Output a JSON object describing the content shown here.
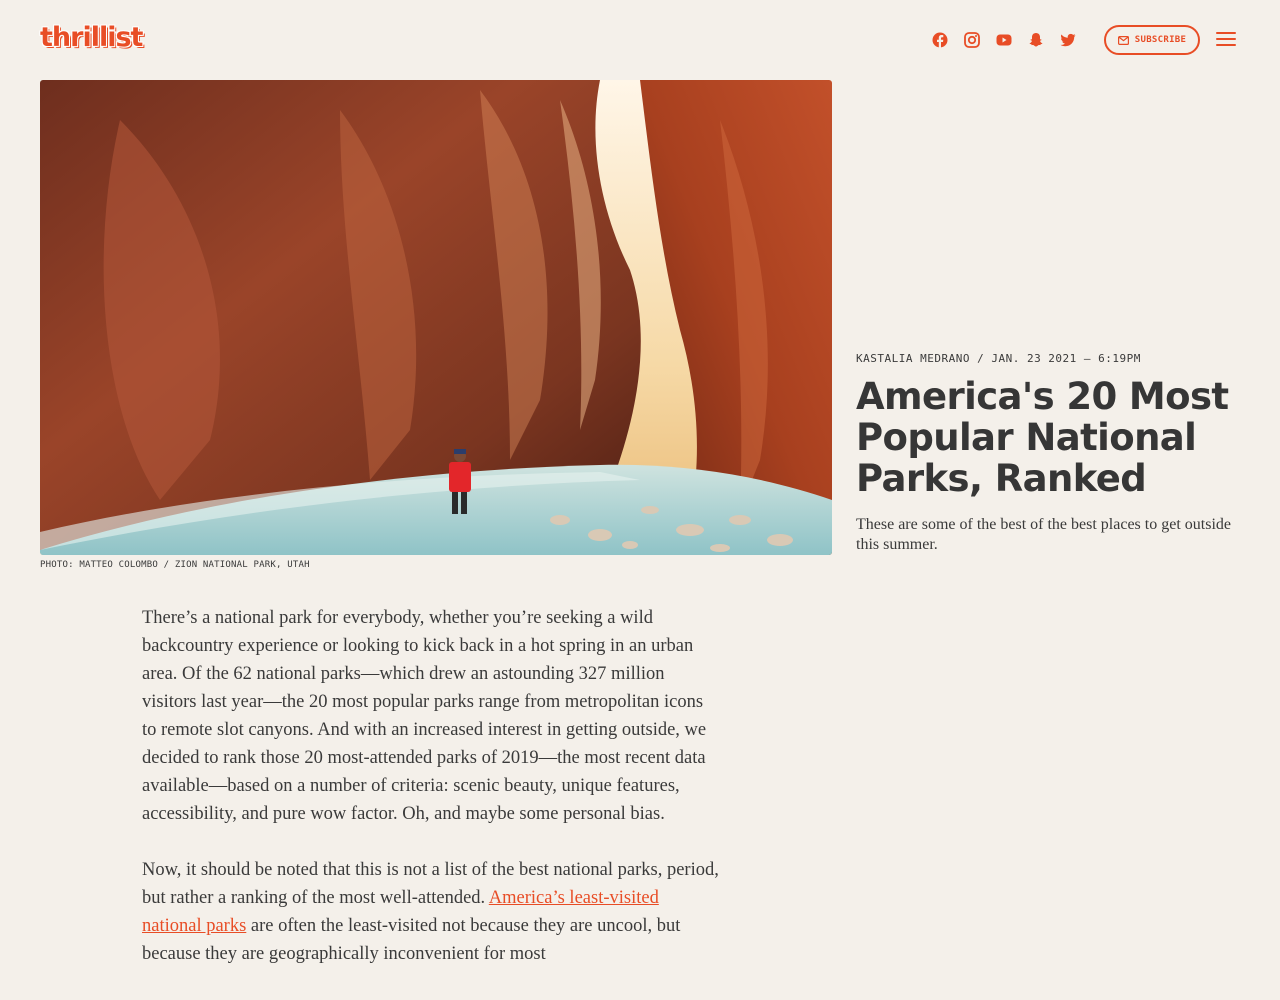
{
  "brand": {
    "logo_text": "thrillist",
    "accent_color": "#e84d26"
  },
  "header": {
    "socials": [
      {
        "name": "facebook-icon"
      },
      {
        "name": "instagram-icon"
      },
      {
        "name": "youtube-icon"
      },
      {
        "name": "snapchat-icon"
      },
      {
        "name": "twitter-icon"
      }
    ],
    "subscribe_label": "SUBSCRIBE",
    "menu_icon": "hamburger-menu-icon"
  },
  "hero": {
    "alt": "Hiker in red shirt wading through a river in a red rock slot canyon",
    "caption": "PHOTO: MATTEO COLOMBO / ZION NATIONAL PARK, UTAH"
  },
  "article": {
    "byline": "KASTALIA MEDRANO / JAN. 23 2021 – 6:19PM",
    "title": "America's 20 Most Popular National Parks, Ranked",
    "dek": "These are some of the best of the best places to get outside this summer.",
    "paragraph1": "There’s a national park for everybody, whether you’re seeking a wild backcountry experience or looking to kick back in a hot spring in an urban area. Of the 62 national parks—which drew an astounding 327 million visitors last year—the 20 most popular parks range from metropolitan icons to remote slot canyons. And with an increased interest in getting outside, we decided to rank those 20 most-attended parks of 2019—the most recent data available—based on a number of criteria: scenic beauty, unique features, accessibility, and pure wow factor. Oh, and maybe some personal bias.",
    "paragraph2_before": "Now, it should be noted that this is not a list of the best national parks, period, but rather a ranking of the most well-attended. ",
    "paragraph2_link": "America’s least-visited national parks",
    "paragraph2_after": " are often the least-visited not because they are uncool, but because they are geographically inconvenient for most"
  }
}
